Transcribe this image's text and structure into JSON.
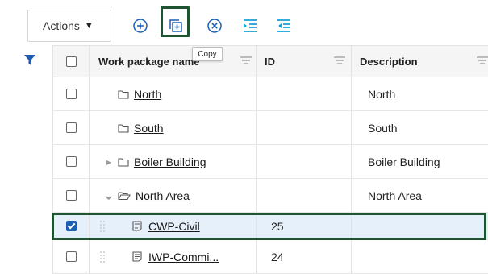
{
  "toolbar": {
    "actions_label": "Actions",
    "icons": [
      "add-icon",
      "copy-icon",
      "delete-icon",
      "indent-icon",
      "outdent-icon"
    ],
    "tooltip": "Copy"
  },
  "grid": {
    "columns": [
      "Work package name",
      "ID",
      "Description"
    ],
    "rows": [
      {
        "name": "North",
        "id": "",
        "description": "North",
        "checked": false,
        "expander": ""
      },
      {
        "name": "South",
        "id": "",
        "description": "South",
        "checked": false,
        "expander": ""
      },
      {
        "name": "Boiler Building",
        "id": "",
        "description": "Boiler Building",
        "checked": false,
        "expander": "collapsed"
      },
      {
        "name": "North Area",
        "id": "",
        "description": "North Area",
        "checked": false,
        "expander": "expanded"
      },
      {
        "name": "CWP-Civil",
        "id": "25",
        "description": "",
        "checked": true,
        "expander": ""
      },
      {
        "name": "IWP-Commi...",
        "id": "24",
        "description": "",
        "checked": false,
        "expander": ""
      }
    ]
  },
  "colors": {
    "accent": "#1a5fb4",
    "highlight": "#1e5430",
    "selected_row": "#e6f0fb"
  }
}
